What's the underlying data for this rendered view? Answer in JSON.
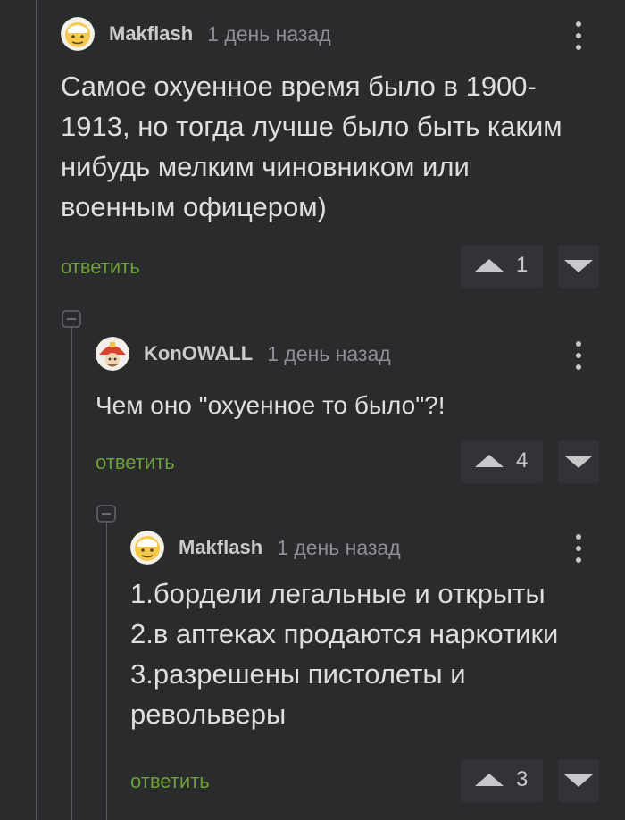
{
  "comments": [
    {
      "username": "Makflash",
      "time": "1 день назад",
      "avatar": "emoji-avatar-icon",
      "body_lines": [
        "Самое охуенное время было в 1900-",
        "1913, но тогда лучше было быть каким",
        "нибудь мелким чиновником или",
        "военным офицером)"
      ],
      "reply_label": "ответить",
      "votes": "1"
    },
    {
      "username": "KonOWALL",
      "time": "1 день назад",
      "avatar": "firefighter-avatar-icon",
      "body_lines": [
        "Чем оно \"охуенное то было\"?!"
      ],
      "reply_label": "ответить",
      "votes": "4"
    },
    {
      "username": "Makflash",
      "time": "1 день назад",
      "avatar": "emoji-avatar-icon",
      "body_lines": [
        "1.бордели легальные и открыты",
        "2.в аптеках продаются наркотики",
        "3.разрешены пистолеты и",
        "револьверы"
      ],
      "reply_label": "ответить",
      "votes": "3"
    }
  ],
  "colors": {
    "background": "#2a2b2d",
    "reply_link": "#6d9f3a",
    "vote_button": "#323336",
    "thread_line": "#56585c"
  }
}
